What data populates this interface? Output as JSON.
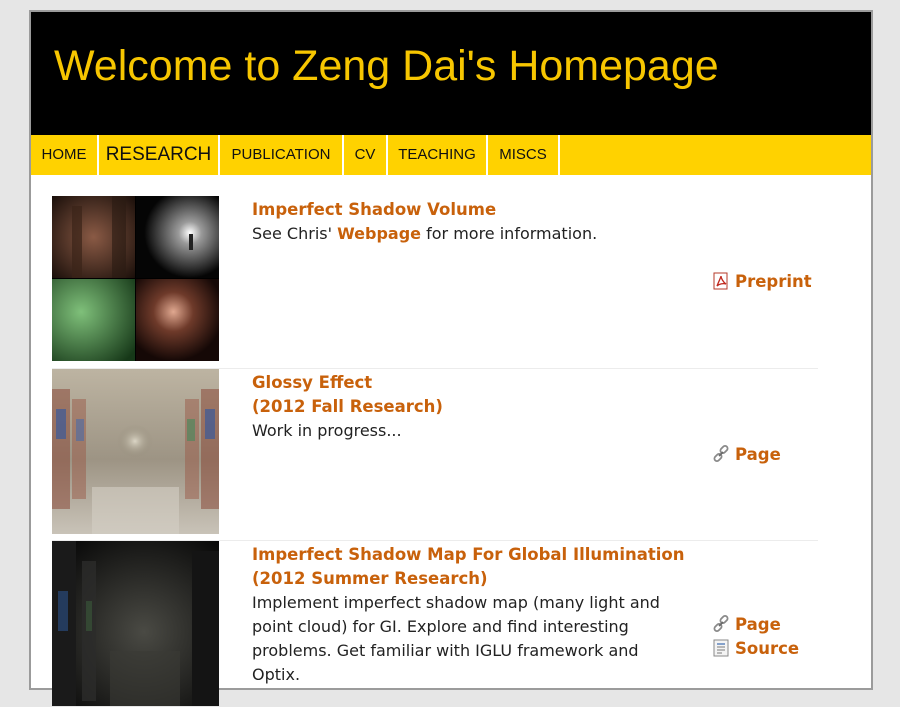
{
  "header": {
    "title": "Welcome to Zeng Dai's Homepage"
  },
  "nav": {
    "items": [
      {
        "label": "HOME"
      },
      {
        "label": "RESEARCH",
        "active": true
      },
      {
        "label": "PUBLICATION"
      },
      {
        "label": "CV"
      },
      {
        "label": "TEACHING"
      },
      {
        "label": "MISCS"
      }
    ]
  },
  "colors": {
    "header_bg": "#000000",
    "title_text": "#f7c600",
    "nav_bg": "#ffd200",
    "link": "#c8610b"
  },
  "projects": [
    {
      "title": "Imperfect Shadow Volume",
      "desc_before": "See Chris' ",
      "desc_link": "Webpage",
      "desc_after": " for more information.",
      "links": [
        {
          "label": "Preprint",
          "icon": "pdf-icon"
        }
      ]
    },
    {
      "title": "Glossy Effect",
      "subtitle": "(2012 Fall Research)",
      "desc": "Work in progress...",
      "links": [
        {
          "label": "Page",
          "icon": "chain-link-icon"
        }
      ]
    },
    {
      "title": "Imperfect Shadow Map For Global Illumination",
      "subtitle": "(2012 Summer Research)",
      "desc_lines": [
        "Implement imperfect shadow map (many light and",
        "point cloud) for GI. Explore and find interesting",
        "problems. Get familiar with IGLU framework and",
        "Optix."
      ],
      "links": [
        {
          "label": "Page",
          "icon": "chain-link-icon"
        },
        {
          "label": "Source",
          "icon": "document-icon"
        }
      ]
    }
  ]
}
